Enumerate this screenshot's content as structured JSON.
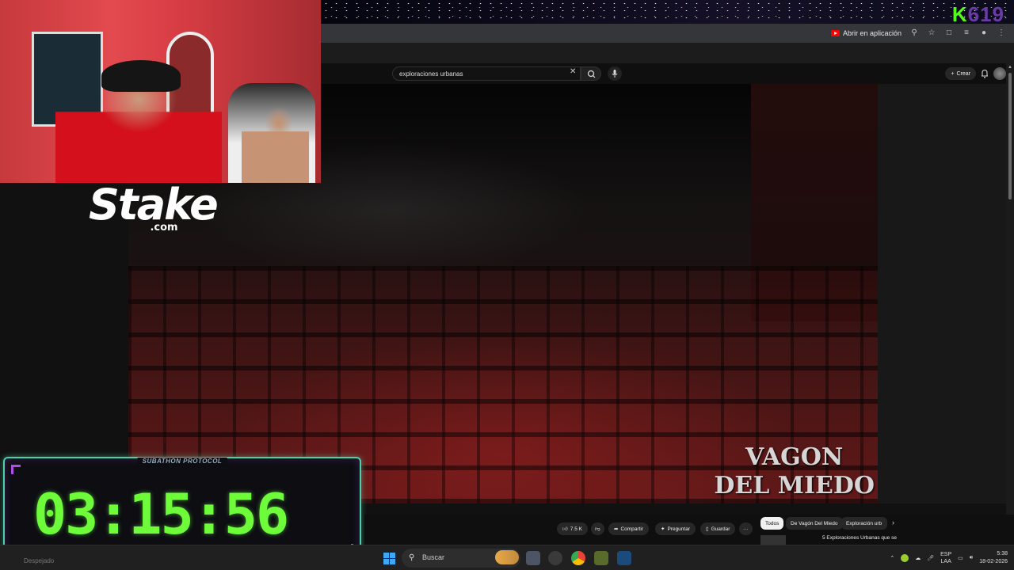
{
  "overlay": {
    "channel_badge": {
      "k": "K",
      "num": "619"
    },
    "sponsor": {
      "name": "Stake",
      "domain": ".com"
    },
    "subathon": {
      "label": "SUBATHON PROTOCOL",
      "timer": "03:15:56"
    }
  },
  "browser": {
    "open_in_app_label": "Abrir en aplicación",
    "icons": [
      "zoom-icon",
      "star-icon",
      "extensions-icon",
      "media-icon",
      "profile-icon",
      "menu-icon"
    ]
  },
  "youtube": {
    "search": {
      "value": "exploraciones urbanas"
    },
    "create_label": "Crear",
    "video": {
      "watermark_line1": "VAGON",
      "watermark_line2": "DEL MIEDO"
    },
    "actions": {
      "likes": "7.5 K",
      "share": "Compartir",
      "ask": "Preguntar",
      "save": "Guardar",
      "more": "···"
    },
    "chips": [
      "Todos",
      "De Vagón Del Miedo",
      "Exploración urb"
    ],
    "recommendation": {
      "title": "5 Exploraciones Urbanas que se"
    }
  },
  "taskbar": {
    "left_text": "Despejado",
    "search_placeholder": "Buscar",
    "language_line1": "ESP",
    "language_line2": "LAA",
    "time": "5:38",
    "date": "18-02-2026"
  },
  "colors": {
    "kick_green": "#53fc18",
    "timer_green": "#6dfb3a",
    "frame_teal": "#4ad1a7",
    "frame_purple": "#b14de6"
  }
}
